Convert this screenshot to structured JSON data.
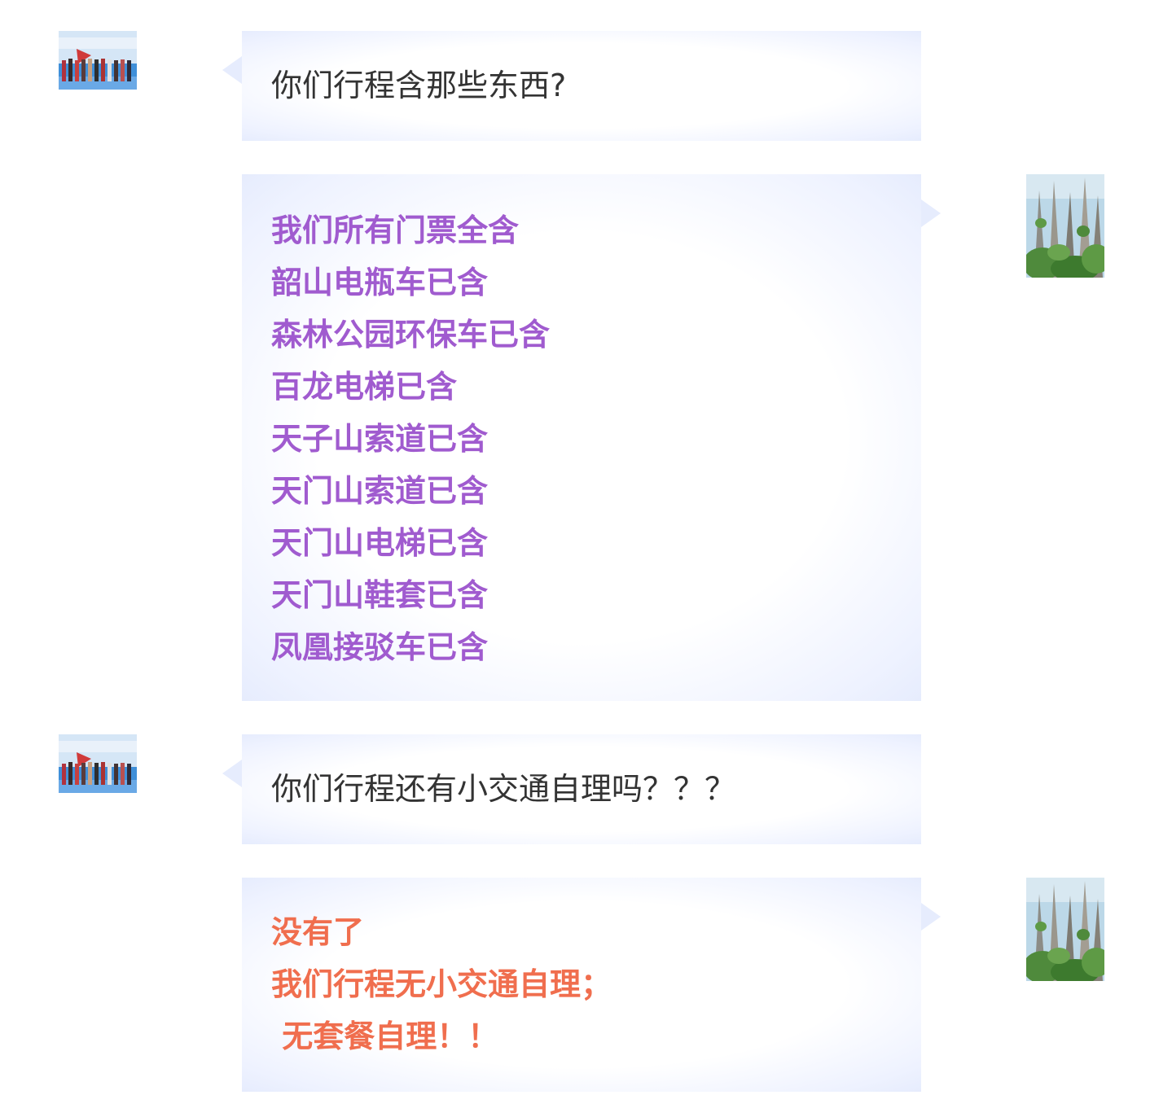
{
  "colors": {
    "bubble_bg": "#e6ecfd",
    "question_text": "#333333",
    "inclusion_text": "#a05bcf",
    "answer_text": "#f06e4e"
  },
  "avatars": {
    "customer": "group-photo-avatar",
    "agent": "scenic-mountain-avatar"
  },
  "messages": [
    {
      "sender": "customer",
      "text": "你们行程含那些东西?"
    },
    {
      "sender": "agent",
      "lines": [
        "我们所有门票全含",
        "韶山电瓶车已含",
        "森林公园环保车已含",
        "百龙电梯已含",
        "天子山索道已含",
        "天门山索道已含",
        "天门山电梯已含",
        "天门山鞋套已含",
        "凤凰接驳车已含"
      ]
    },
    {
      "sender": "customer",
      "text": "你们行程还有小交通自理吗？？？"
    },
    {
      "sender": "agent",
      "lines": [
        "没有了",
        "我们行程无小交通自理；",
        " 无套餐自理！！"
      ]
    }
  ]
}
